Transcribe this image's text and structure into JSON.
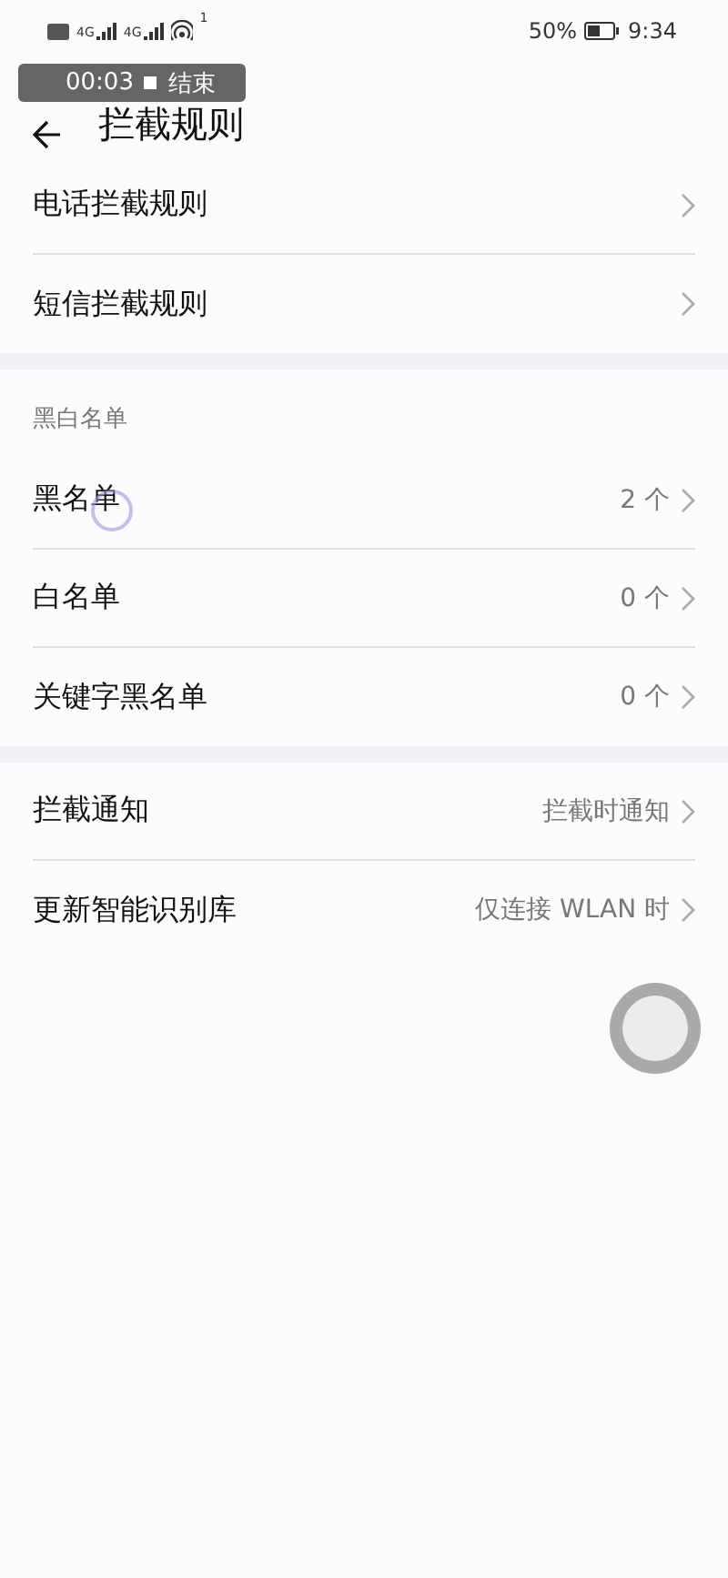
{
  "status_bar": {
    "network_1": "4G",
    "network_2": "4G",
    "hotspot_count": "1",
    "battery": "50%",
    "time": "9:34"
  },
  "recording": {
    "time": "00:03",
    "stop": "结束"
  },
  "header": {
    "title": "拦截规则"
  },
  "sections": [
    {
      "items": [
        {
          "label": "电话拦截规则"
        },
        {
          "label": "短信拦截规则"
        }
      ]
    },
    {
      "heading": "黑白名单",
      "items": [
        {
          "label": "黑名单",
          "value": "2 个"
        },
        {
          "label": "白名单",
          "value": "0 个"
        },
        {
          "label": "关键字黑名单",
          "value": "0 个"
        }
      ]
    },
    {
      "items": [
        {
          "label": "拦截通知",
          "value": "拦截时通知"
        },
        {
          "label": "更新智能识别库",
          "value": "仅连接 WLAN 时"
        }
      ]
    }
  ]
}
